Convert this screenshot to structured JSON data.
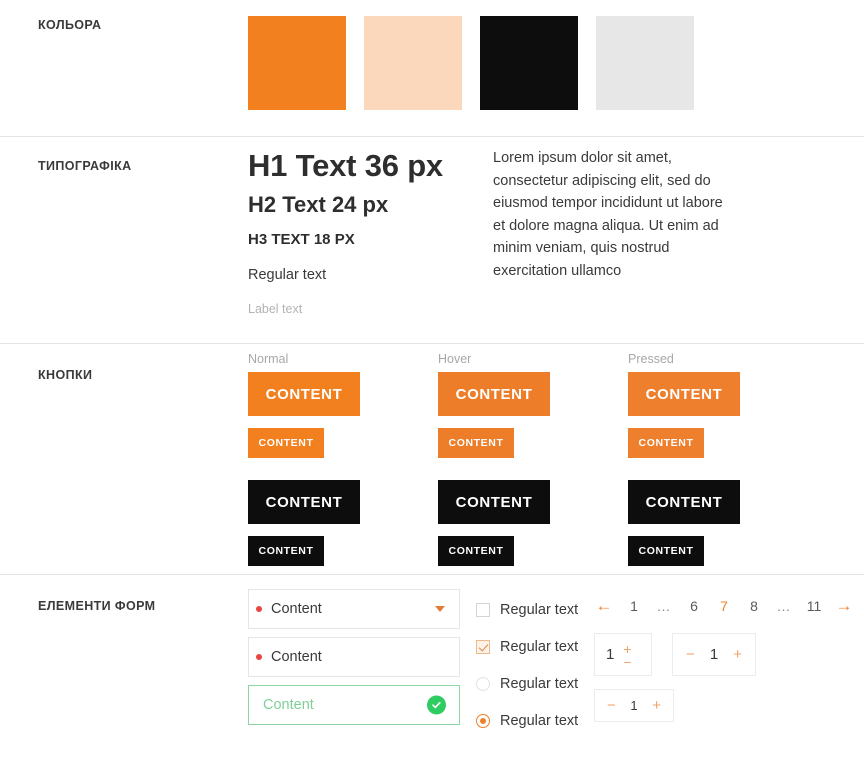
{
  "sections": {
    "colors": {
      "label": "КОЛЬОРА",
      "swatches": [
        {
          "name": "primary-orange",
          "hex": "#F2801F"
        },
        {
          "name": "light-peach",
          "hex": "#FBD7BC"
        },
        {
          "name": "black",
          "hex": "#0D0D0D"
        },
        {
          "name": "light-gray",
          "hex": "#E7E7E7"
        }
      ]
    },
    "typography": {
      "label": "ТИПОГРАФІКА",
      "h1": "H1 Text 36 px",
      "h2": "H2 Text 24 px",
      "h3": "H3 TEXT 18 PX",
      "regular": "Regular text",
      "small_label": "Label text",
      "paragraph": "Lorem ipsum dolor sit amet, consectetur adipiscing elit, sed do eiusmod tempor incididunt ut labore et dolore magna aliqua. Ut enim ad minim veniam, quis nostrud exercitation ullamco"
    },
    "buttons": {
      "label": "КНОПКИ",
      "columns": [
        {
          "state": "Normal",
          "primary_large": "CONTENT",
          "primary_small": "CONTENT",
          "dark_large": "CONTENT",
          "dark_small": "CONTENT",
          "primary_color": "#F2801F",
          "dark_color": "#0D0D0D"
        },
        {
          "state": "Hover",
          "primary_large": "CONTENT",
          "primary_small": "CONTENT",
          "dark_large": "CONTENT",
          "dark_small": "CONTENT",
          "primary_color": "#ED7D28",
          "dark_color": "#0D0D0D"
        },
        {
          "state": "Pressed",
          "primary_large": "CONTENT",
          "primary_small": "CONTENT",
          "dark_large": "CONTENT",
          "dark_small": "CONTENT",
          "primary_color": "#EE7F2D",
          "dark_color": "#0D0D0D"
        }
      ]
    },
    "forms": {
      "label": "ЕЛЕМЕНТИ ФОРМ",
      "fields": [
        {
          "name": "select-field",
          "value": "Content",
          "type": "select",
          "state": "default"
        },
        {
          "name": "text-field",
          "value": "Content",
          "type": "text",
          "state": "default"
        },
        {
          "name": "success-field",
          "value": "Content",
          "type": "text",
          "state": "success"
        }
      ],
      "choices": [
        {
          "control": "checkbox",
          "checked": false,
          "label": "Regular text"
        },
        {
          "control": "checkbox",
          "checked": true,
          "label": "Regular text"
        },
        {
          "control": "radio",
          "checked": false,
          "label": "Regular text"
        },
        {
          "control": "radio",
          "checked": true,
          "label": "Regular text"
        }
      ],
      "pagination": {
        "prev_icon": "←",
        "next_icon": "→",
        "items": [
          "1",
          "…",
          "6",
          "7",
          "8",
          "…",
          "11"
        ],
        "active": "7",
        "active_color": "#EE7F2D"
      },
      "steppers": [
        {
          "name": "vertical-stepper",
          "value": "1",
          "increment_icon": "+",
          "decrement_icon": "−",
          "orientation": "vertical"
        },
        {
          "name": "horizontal-stepper",
          "value": "1",
          "increment_icon": "+",
          "decrement_icon": "−",
          "orientation": "horizontal"
        },
        {
          "name": "horizontal-stepper-small",
          "value": "1",
          "increment_icon": "+",
          "decrement_icon": "−",
          "orientation": "horizontal"
        }
      ]
    }
  }
}
